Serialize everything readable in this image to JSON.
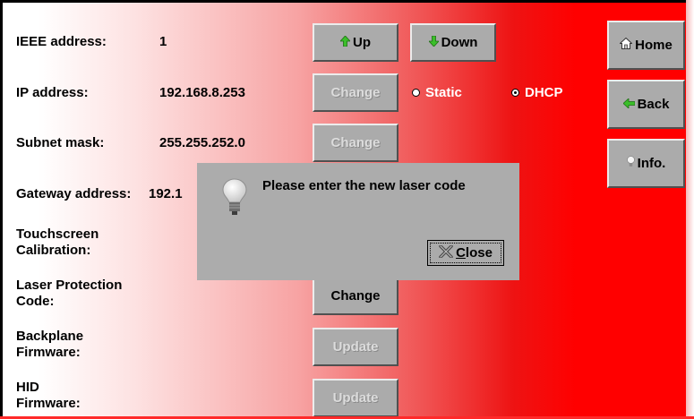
{
  "rows": [
    {
      "label": "IEEE address:",
      "value": "1"
    },
    {
      "label": "IP address:",
      "value": "192.168.8.253"
    },
    {
      "label": "Subnet mask:",
      "value": "255.255.252.0"
    },
    {
      "label": "Gateway address:",
      "value": "192.1"
    },
    {
      "label_line1": "Touchscreen",
      "label_line2": "Calibration:"
    },
    {
      "label_line1": "Laser Protection",
      "label_line2": "Code:"
    },
    {
      "label_line1": "Backplane",
      "label_line2": "Firmware:"
    },
    {
      "label_line1": "HID",
      "label_line2": "Firmware:"
    }
  ],
  "buttons": {
    "up": "Up",
    "down": "Down",
    "change": "Change",
    "update": "Update",
    "home": "Home",
    "back": "Back",
    "info": "Info."
  },
  "radios": {
    "static": "Static",
    "dhcp": "DHCP",
    "selected": "DHCP"
  },
  "dialog": {
    "message": "Please enter the new laser code",
    "close_prefix": "C",
    "close_rest": "lose"
  },
  "colors": {
    "accent_red": "#ff0000",
    "button_gray": "#ababab",
    "arrow_green": "#3bbf2a"
  },
  "icons": {
    "up": "up-arrow-icon",
    "down": "down-arrow-icon",
    "home": "home-icon",
    "back": "left-arrow-icon",
    "info": "lightbulb-icon",
    "close": "close-x-icon"
  }
}
